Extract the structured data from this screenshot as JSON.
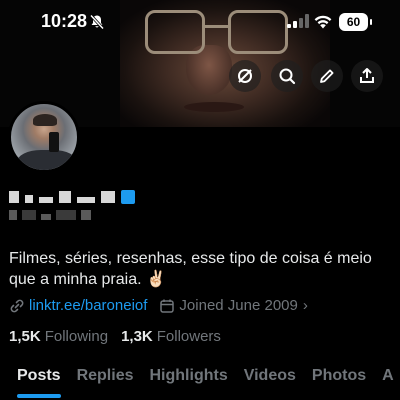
{
  "status_bar": {
    "time": "10:28",
    "battery": "60"
  },
  "header": {
    "icons": [
      "bell-off-icon",
      "signal-icon",
      "wifi-icon",
      "remove-icon",
      "search-icon",
      "edit-icon",
      "share-icon"
    ]
  },
  "profile": {
    "bio_line1": "Filmes, séries, resenhas, esse tipo de coisa é meio",
    "bio_line2": "que a minha praia. ✌🏻",
    "link": "linktr.ee/baroneiof",
    "joined": "Joined June 2009",
    "following_count": "1,5K",
    "following_label": "Following",
    "followers_count": "1,3K",
    "followers_label": "Followers"
  },
  "tabs": [
    {
      "label": "Posts",
      "active": true
    },
    {
      "label": "Replies",
      "active": false
    },
    {
      "label": "Highlights",
      "active": false
    },
    {
      "label": "Videos",
      "active": false
    },
    {
      "label": "Photos",
      "active": false
    },
    {
      "label": "A",
      "active": false
    }
  ],
  "colors": {
    "accent": "#1d9bf0",
    "background": "#000000",
    "text": "#e7e9ea",
    "muted": "#71767b"
  }
}
